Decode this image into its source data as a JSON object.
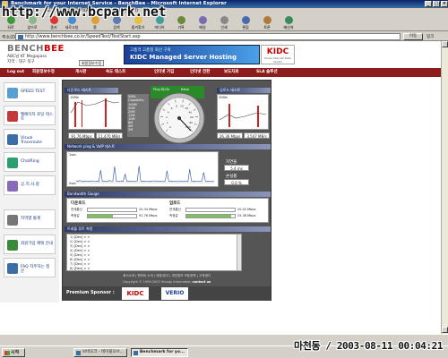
{
  "watermark": "http://www.bcpark.net",
  "window": {
    "title": "Benchmark for your Internet Service - BenchBee - Microsoft Internet Explorer",
    "minimize": "_",
    "maximize": "□",
    "close": "×"
  },
  "menu": [
    "파일(F)",
    "편집(E)",
    "보기(V)",
    "즐겨찾기(A)",
    "도구(T)",
    "도움말(H)"
  ],
  "toolbar": [
    "뒤로",
    "앞으로",
    "중지",
    "새로고침",
    "홈",
    "검색",
    "즐겨찾기",
    "미디어",
    "기록",
    "메일",
    "인쇄",
    "편집",
    "토론",
    "메신저"
  ],
  "address": {
    "label": "주소(D)",
    "url": "http://www.benchbee.co.kr/SpeedTest/TestStart.asp",
    "go": "이동",
    "links": "링크"
  },
  "logo": {
    "bench": "BENCH",
    "bee": "BEE"
  },
  "user": {
    "line1": "ABC님  KT Megapass",
    "line2": "지역 : 대구 북구",
    "edit": "회원정보수정"
  },
  "banner": {
    "line1": "고품격 고품질 회선 구축",
    "line2": "KIDC Managed Server Hosting"
  },
  "kidc": {
    "logo": "KIDC",
    "sub": "Korea Internet Data Center"
  },
  "nav": {
    "logout": "Log out",
    "items": [
      "회원정보수정",
      "게시판",
      "속도 테스트",
      "인터넷 가입",
      "인터넷 전환",
      "보도자료",
      "SLA 솔루션"
    ]
  },
  "sidebar": [
    {
      "label": "SPEED TEST",
      "icon": "speed-test-icon",
      "color": "#5a9fd4"
    },
    {
      "label": "웹페이지 로딩 테스트",
      "icon": "web-loading-icon",
      "color": "#c23a3a"
    },
    {
      "label": "Visual Traceroute",
      "icon": "traceroute-icon",
      "color": "#3a6ea5"
    },
    {
      "label": "ChatRing",
      "icon": "chat-icon",
      "color": "#2aa070"
    },
    {
      "label": "공.지.사.항",
      "icon": "notice-icon",
      "color": "#8a6ab8"
    },
    {
      "label": "지역별 통계",
      "icon": "stats-icon",
      "color": "#777777"
    },
    {
      "label": "회원가입 혜택 안내",
      "icon": "member-icon",
      "color": "#3a8a3a"
    },
    {
      "label": "FAQ 자주하는 질문",
      "icon": "faq-icon",
      "color": "#3a6ea5"
    }
  ],
  "tests": {
    "download_title": "다운로드 테스트",
    "upload_title": "업로드 테스트",
    "download_scale": "15Mb",
    "upload_scale": "30Mb",
    "download_mbps": "91.76 Mbps",
    "download_kbs": "11,470 MB/s",
    "upload_mbps": "26.36 Mbps",
    "upload_kbs": "3,547 MB/s",
    "vdsl": {
      "label": "VDSL Capability",
      "rows": [
        "100M",
        "50M",
        "20M",
        "13M",
        "10M",
        "8M",
        "4M",
        "2M"
      ]
    },
    "gauge_tabs": [
      "Ping 테스트",
      "Ratio"
    ],
    "gauge_labels": [
      "0",
      "1",
      "2",
      "4",
      "6",
      "8",
      "10",
      "20",
      "40",
      "60",
      "80",
      "100"
    ]
  },
  "ping": {
    "title": "Network ping & VoIP 테스트",
    "y_top": "1sec",
    "y_bottom": "0sec",
    "latency_label": "지연율",
    "latency_value": "5.4 ms",
    "loss_label": "손실률",
    "loss_value": "0.0 %",
    "chart_data": {
      "type": "line",
      "y_top": "1sec",
      "y_bottom": "0sec",
      "values": [
        0.07,
        0.04,
        0.08,
        0.05,
        0.04,
        0.06,
        0.05,
        0.06,
        0.04,
        0.07,
        0.05,
        0.05,
        0.06,
        0.04,
        0.46,
        0.05,
        0.06,
        0.05,
        0.04,
        0.08,
        0.05,
        0.05,
        0.6,
        0.06,
        0.04,
        0.05,
        0.06,
        0.05,
        0.32,
        0.05,
        0.04,
        0.06,
        0.05,
        0.04,
        0.05,
        0.06,
        0.62,
        0.05,
        0.04,
        0.06,
        0.05,
        0.05,
        0.04,
        0.06,
        0.05,
        0.07,
        0.04,
        0.05,
        0.06,
        0.05,
        0.04,
        0.06,
        0.44,
        0.05,
        0.04,
        0.06,
        0.05,
        0.04,
        0.05,
        0.07,
        0.04,
        0.05,
        0.06,
        0.05,
        0.04,
        0.5,
        0.05,
        0.04,
        0.06,
        0.05,
        0.05,
        0.04,
        0.06,
        0.38,
        0.05,
        0.04,
        0.06,
        0.05,
        0.04,
        0.05
      ]
    }
  },
  "bandwidth": {
    "title": "Bandwidth Gauge",
    "download_label": "다운로드",
    "upload_label": "업로드",
    "contract_label": "연계통신",
    "measured_label": "측정값",
    "download_contract": "20.34 Mbps",
    "download_measured": "91.76 Mbps",
    "upload_contract": "20.02 Mbps",
    "upload_measured": "25.38 Mbps",
    "download_fill": 0.52,
    "upload_fill": 0.92
  },
  "trace": {
    "title": "트래블 루트 측정",
    "hops": [
      "1)  [Dev]  > >",
      "2)  [Dev]  > >",
      "3)  [Dev]  > >",
      "4)  [Dev]  > >",
      "5)  [Dev]  > >",
      "6)  [Dev]  > >",
      "7)  [Dev]  > >",
      "8)  [Dev]  > >"
    ]
  },
  "footer": {
    "links": "회사소개 | 벤치비 소개 | 제휴/광고 | 개인정보 보호정책 | 고객센터",
    "copyright": "Copyright © 1999-2003 Youngs Information",
    "contact": "contact us"
  },
  "sponsor": {
    "label": "Premium Sponsor :",
    "kidc": "KIDC",
    "verio": "VERIO"
  },
  "taskbar": {
    "start": "시작",
    "tasks": [
      {
        "label": "보바오크 - 테이블오브...",
        "active": false
      },
      {
        "label": "Benchmark for yo...",
        "active": true
      }
    ]
  },
  "clock": "마천동 / 2003-08-11 00:04:21"
}
